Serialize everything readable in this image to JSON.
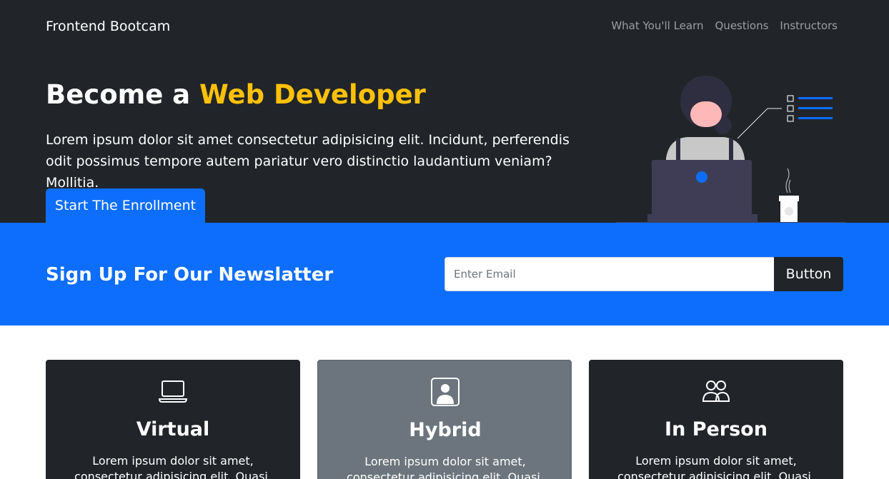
{
  "navbar": {
    "brand": "Frontend Bootcam",
    "links": [
      "What You'll Learn",
      "Questions",
      "Instructors"
    ]
  },
  "hero": {
    "title_prefix": "Become a ",
    "title_accent": "Web Developer",
    "text": "Lorem ipsum dolor sit amet consectetur adipisicing elit. Incidunt, perferendis odit possimus tempore autem pariatur vero distinctio laudantium veniam? Mollitia.",
    "cta_label": "Start The Enrollment",
    "illustration": "person-at-laptop-illustration"
  },
  "newsletter": {
    "title": "Sign Up For Our Newslatter",
    "email_placeholder": "Enter Email",
    "button_label": "Button"
  },
  "cards": [
    {
      "icon": "laptop-icon",
      "title": "Virtual",
      "text": "Lorem ipsum dolor sit amet, consectetur adipisicing elit. Quasi, corrupti culpa."
    },
    {
      "icon": "person-badge-icon",
      "title": "Hybrid",
      "text": "Lorem ipsum dolor sit amet, consectetur adipisicing elit. Quasi, corrupti culpa."
    },
    {
      "icon": "people-icon",
      "title": "In Person",
      "text": "Lorem ipsum dolor sit amet, consectetur adipisicing elit. Quasi, corrupti culpa."
    }
  ],
  "colors": {
    "dark": "#212529",
    "primary": "#0d6efd",
    "accent": "#ffc107",
    "secondary": "#6c757d"
  }
}
